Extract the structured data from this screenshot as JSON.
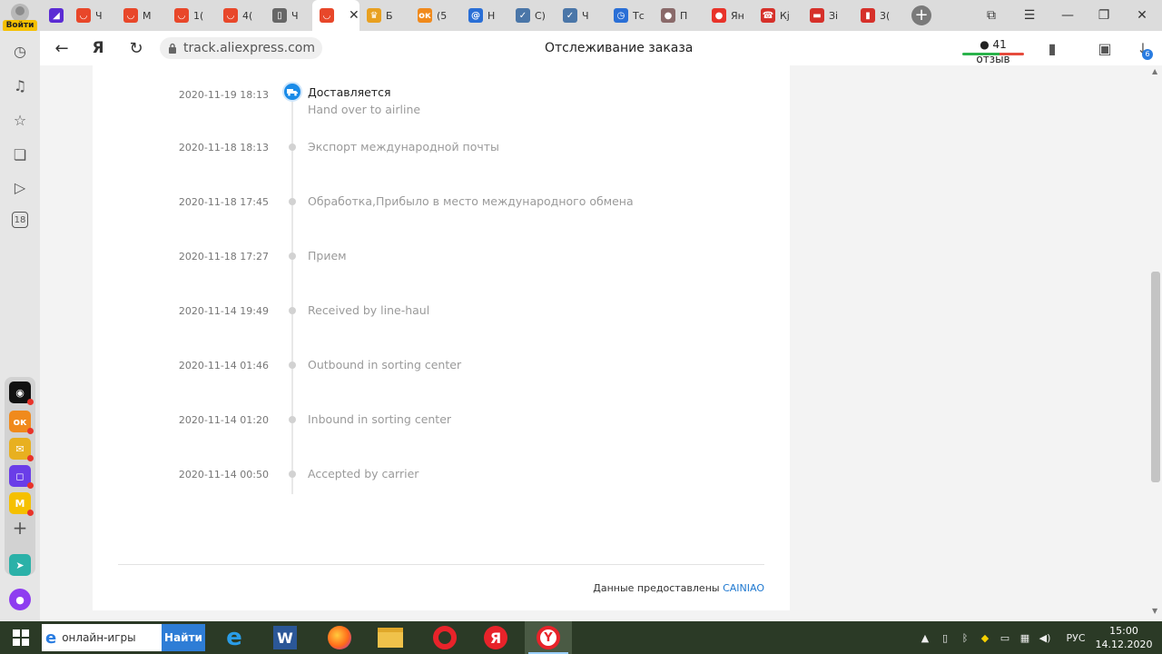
{
  "browser": {
    "profile_login": "Войти",
    "tabs": [
      {
        "label": "",
        "icon": "yandex-zen-icon",
        "color": "#5b2bd4"
      },
      {
        "label": "Ч",
        "icon": "aliexpress-icon",
        "color": "#e8472a"
      },
      {
        "label": "М",
        "icon": "aliexpress-icon",
        "color": "#e8472a"
      },
      {
        "label": "1(",
        "icon": "aliexpress-icon",
        "color": "#e8472a"
      },
      {
        "label": "4(",
        "icon": "aliexpress-icon",
        "color": "#e8472a"
      },
      {
        "label": "Ч",
        "icon": "document-icon",
        "color": "#666666"
      },
      {
        "label": "",
        "icon": "aliexpress-icon",
        "color": "#e8472a",
        "active": true
      },
      {
        "label": "Б",
        "icon": "crown-icon",
        "color": "#e8a020"
      },
      {
        "label": "(5",
        "icon": "odnoklassniki-icon",
        "color": "#f08a1c"
      },
      {
        "label": "Н",
        "icon": "at-sign-icon",
        "color": "#2a6fd6"
      },
      {
        "label": "С)",
        "icon": "vk-check-icon",
        "color": "#4a76a8"
      },
      {
        "label": "Ч",
        "icon": "vk-check-icon",
        "color": "#4a76a8"
      },
      {
        "label": "Тс",
        "icon": "clock-icon",
        "color": "#2a6fd6"
      },
      {
        "label": "П",
        "icon": "avatar-icon",
        "color": "#8a6a6a"
      },
      {
        "label": "Ян",
        "icon": "map-pin-icon",
        "color": "#e8332a"
      },
      {
        "label": "Кј",
        "icon": "phone-icon",
        "color": "#d6302a"
      },
      {
        "label": "Зі",
        "icon": "card-icon",
        "color": "#d6302a"
      },
      {
        "label": "3(",
        "icon": "bottle-icon",
        "color": "#d6302a"
      }
    ],
    "url": "track.aliexpress.com",
    "page_title": "Отслеживание заказа",
    "reviews_label": "41 отзыв",
    "downloads_count": "6"
  },
  "tracking": {
    "events": [
      {
        "time": "2020-11-19 18:13",
        "title": "Доставляется",
        "subtitle": "Hand over to airline"
      },
      {
        "time": "2020-11-18 18:13",
        "title": "Экспорт международной почты"
      },
      {
        "time": "2020-11-18 17:45",
        "title": "Обработка,Прибыло в место международного обмена"
      },
      {
        "time": "2020-11-18 17:27",
        "title": "Прием"
      },
      {
        "time": "2020-11-14 19:49",
        "title": "Received by line-haul"
      },
      {
        "time": "2020-11-14 01:46",
        "title": "Outbound in sorting center"
      },
      {
        "time": "2020-11-14 01:20",
        "title": "Inbound in sorting center"
      },
      {
        "time": "2020-11-14 00:50",
        "title": "Accepted by carrier"
      }
    ],
    "provided_by_label": "Данные предоставлены",
    "provider_link": "CAINIAO"
  },
  "sidebar": {
    "apps": [
      {
        "icon": "music-app-icon",
        "color": "#111111"
      },
      {
        "icon": "odnoklassniki-icon",
        "color": "#f08a1c"
      },
      {
        "icon": "mail-icon",
        "color": "#e8b020"
      },
      {
        "icon": "messenger-icon",
        "color": "#6a3de8"
      },
      {
        "icon": "market-icon",
        "color": "#f5c000",
        "label": "Маркет"
      }
    ]
  },
  "taskbar": {
    "search_text": "онлайн-игры",
    "search_button": "Найти",
    "language": "РУС",
    "time": "15:00",
    "date": "14.12.2020"
  }
}
